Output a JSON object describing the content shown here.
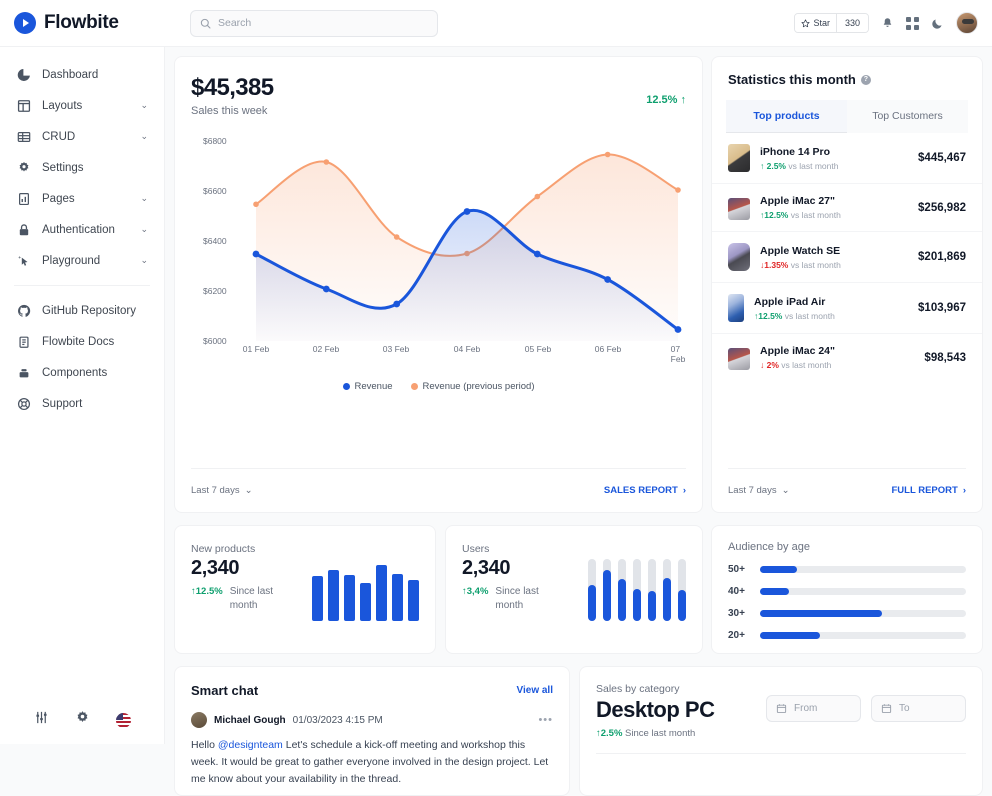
{
  "header": {
    "brand": "Flowbite",
    "search_placeholder": "Search",
    "search_value": "",
    "star_label": "Star",
    "star_count": "330"
  },
  "sidebar": {
    "items": [
      {
        "label": "Dashboard",
        "icon": "pie-chart-icon",
        "expandable": false
      },
      {
        "label": "Layouts",
        "icon": "layout-icon",
        "expandable": true
      },
      {
        "label": "CRUD",
        "icon": "table-icon",
        "expandable": true
      },
      {
        "label": "Settings",
        "icon": "gear-icon",
        "expandable": false
      },
      {
        "label": "Pages",
        "icon": "chart-bar-icon",
        "expandable": true
      },
      {
        "label": "Authentication",
        "icon": "lock-icon",
        "expandable": true
      },
      {
        "label": "Playground",
        "icon": "cursor-sparkle-icon",
        "expandable": true
      }
    ],
    "secondary": [
      {
        "label": "GitHub Repository",
        "icon": "github-icon"
      },
      {
        "label": "Flowbite Docs",
        "icon": "document-icon"
      },
      {
        "label": "Components",
        "icon": "components-icon"
      },
      {
        "label": "Support",
        "icon": "lifebuoy-icon"
      }
    ],
    "chevron": "⌄"
  },
  "sales": {
    "amount": "$45,385",
    "subtitle": "Sales this week",
    "delta": "12.5% ↑",
    "range_label": "Last 7 days",
    "report_label": "SALES REPORT",
    "report_arrow": "›",
    "chevron": "⌄"
  },
  "chart_data": {
    "type": "line",
    "title": "Sales this week",
    "xlabel": "",
    "ylabel": "",
    "ylim": [
      6000,
      6800
    ],
    "yticks": [
      "$6000",
      "$6200",
      "$6400",
      "$6600",
      "$6800"
    ],
    "grid": false,
    "legend_position": "bottom",
    "categories": [
      "01 Feb",
      "02 Feb",
      "03 Feb",
      "04 Feb",
      "05 Feb",
      "06 Feb",
      "07 Feb"
    ],
    "series": [
      {
        "name": "Revenue",
        "color": "#1a56db",
        "values": [
          6348,
          6208,
          6148,
          6518,
          6348,
          6246,
          6046
        ]
      },
      {
        "name": "Revenue (previous period)",
        "color": "#f7a072",
        "values": [
          6547,
          6716,
          6416,
          6350,
          6578,
          6746,
          6604
        ]
      }
    ]
  },
  "statistics": {
    "title": "Statistics this month",
    "info_glyph": "?",
    "tabs": [
      {
        "label": "Top products",
        "active": true
      },
      {
        "label": "Top Customers",
        "active": false
      }
    ],
    "products": [
      {
        "name": "iPhone 14 Pro",
        "change": "↑ 2.5%",
        "direction": "up",
        "note": "vs last month",
        "value": "$445,467",
        "icon": "iphone-14-pro-image"
      },
      {
        "name": "Apple iMac 27\"",
        "change": "↑12.5%",
        "direction": "up",
        "note": "vs last month",
        "value": "$256,982",
        "icon": "imac-27-image"
      },
      {
        "name": "Apple Watch SE",
        "change": "↓1.35%",
        "direction": "down",
        "note": "vs last month",
        "value": "$201,869",
        "icon": "apple-watch-se-image"
      },
      {
        "name": "Apple iPad Air",
        "change": "↑12.5%",
        "direction": "up",
        "note": "vs last month",
        "value": "$103,967",
        "icon": "ipad-air-image"
      },
      {
        "name": "Apple iMac 24\"",
        "change": "↓ 2%",
        "direction": "down",
        "note": "vs last month",
        "value": "$98,543",
        "icon": "imac-24-image"
      }
    ],
    "range_label": "Last 7 days",
    "report_label": "FULL REPORT",
    "report_arrow": "›",
    "chevron": "⌄"
  },
  "new_products": {
    "label": "New products",
    "value": "2,340",
    "pct": "↑12.5%",
    "since": "Since last month",
    "chart": {
      "type": "bar",
      "values": [
        74,
        84,
        76,
        62,
        92,
        78,
        68
      ],
      "color": "#1a56db"
    }
  },
  "users": {
    "label": "Users",
    "value": "2,340",
    "pct": "↑3,4%",
    "since": "Since last month",
    "chart": {
      "type": "bar",
      "values": [
        58,
        82,
        67,
        52,
        48,
        70,
        50
      ],
      "color": "#1a56db",
      "track_color": "#e1e4e9"
    }
  },
  "audience": {
    "title": "Audience by age",
    "chart": {
      "type": "bar",
      "orientation": "horizontal",
      "categories": [
        "50+",
        "40+",
        "30+",
        "20+"
      ],
      "values": [
        18,
        14,
        59,
        29
      ],
      "color": "#1a56db"
    }
  },
  "chat": {
    "title": "Smart chat",
    "view_all": "View all",
    "author": "Michael Gough",
    "timestamp": "01/03/2023 4:15 PM",
    "more_glyph": "•••",
    "message_prefix": "Hello ",
    "mention": "@designteam",
    "message_body": " Let's schedule a kick-off meeting and workshop this week. It would be great to gather everyone involved in the design project. Let me know about your availability in the thread."
  },
  "category": {
    "label": "Sales by category",
    "value": "Desktop PC",
    "pct": "↑2.5%",
    "since": "Since last month",
    "from_placeholder": "From",
    "to_placeholder": "To"
  }
}
